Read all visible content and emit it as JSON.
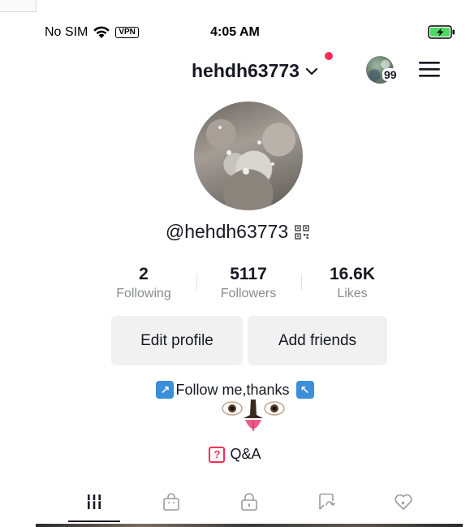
{
  "status_bar": {
    "carrier": "No SIM",
    "vpn": "VPN",
    "time": "4:05 AM"
  },
  "header": {
    "username": "hehdh63773",
    "story_count": "99"
  },
  "profile": {
    "handle": "@hehdh63773",
    "stats": [
      {
        "value": "2",
        "label": "Following"
      },
      {
        "value": "5117",
        "label": "Followers"
      },
      {
        "value": "16.6K",
        "label": "Likes"
      }
    ],
    "buttons": {
      "edit": "Edit profile",
      "add": "Add friends"
    },
    "bio": "Follow me,thanks",
    "qa_label": "Q&A"
  },
  "tabs": [
    {
      "icon": "videos-grid-icon",
      "active": true
    },
    {
      "icon": "shop-bag-icon",
      "active": false
    },
    {
      "icon": "private-lock-icon",
      "active": false
    },
    {
      "icon": "reposts-icon",
      "active": false
    },
    {
      "icon": "liked-heart-icon",
      "active": false
    }
  ],
  "colors": {
    "accent": "#fe2c55",
    "text": "#161823",
    "muted": "#8a8b91",
    "button_bg": "#f1f1f2"
  }
}
